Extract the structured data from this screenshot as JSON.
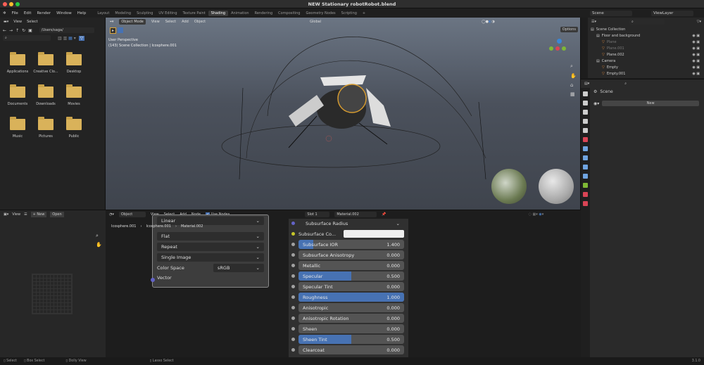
{
  "window": {
    "title": "NEW Stationary robotRobot.blend"
  },
  "menu": [
    "File",
    "Edit",
    "Render",
    "Window",
    "Help"
  ],
  "workspaces": [
    "Layout",
    "Modeling",
    "Sculpting",
    "UV Editing",
    "Texture Paint",
    "Shading",
    "Animation",
    "Rendering",
    "Compositing",
    "Geometry Nodes",
    "Scripting",
    "+"
  ],
  "active_workspace": "Shading",
  "scene": {
    "scene_name": "Scene",
    "view_layer": "ViewLayer"
  },
  "file_browser": {
    "menu": [
      "View",
      "Select"
    ],
    "path": "/Users/saga/",
    "search_placeholder": "",
    "folders": [
      "Applications",
      "Creative Clo...",
      "Desktop",
      "Documents",
      "Downloads",
      "Movies",
      "Music",
      "Pictures",
      "Public"
    ]
  },
  "viewport": {
    "mode": "Object Mode",
    "menu": [
      "View",
      "Select",
      "Add",
      "Object"
    ],
    "orientation": "Global",
    "options": "Options",
    "perspective": "User Perspective",
    "collection_info": "(143) Scene Collection | Icosphere.001"
  },
  "outliner": {
    "items": [
      {
        "label": "Scene Collection",
        "level": 0
      },
      {
        "label": "Floor and background",
        "level": 1
      },
      {
        "label": "Plane",
        "level": 2
      },
      {
        "label": "Plane.001",
        "level": 2
      },
      {
        "label": "Plane.002",
        "level": 2
      },
      {
        "label": "Camera",
        "level": 1
      },
      {
        "label": "Empty",
        "level": 2
      },
      {
        "label": "Empty.001",
        "level": 2
      }
    ]
  },
  "properties": {
    "scene_label": "Scene",
    "new_button": "New"
  },
  "image_editor": {
    "view": "View",
    "new": "New",
    "open": "Open"
  },
  "node_editor": {
    "type": "Object",
    "menu": [
      "View",
      "Select",
      "Add",
      "Node"
    ],
    "use_nodes": "Use Nodes",
    "slot": "Slot 1",
    "material": "Material.002",
    "breadcrumb": [
      "Icosphere.001",
      "Icosphere.001",
      "Material.002"
    ]
  },
  "image_node": {
    "interp": "Linear",
    "projection": "Flat",
    "extension": "Repeat",
    "source": "Single Image",
    "color_space_label": "Color Space",
    "color_space": "sRGB",
    "vector": "Vector"
  },
  "bsdf": {
    "subsurface_radius": "Subsurface Radius",
    "subsurface_color": "Subsurface Co...",
    "rows": [
      {
        "label": "Subsurface IOR",
        "value": "1.400",
        "fill": 0.14
      },
      {
        "label": "Subsurface Anisotropy",
        "value": "0.000",
        "fill": 0
      },
      {
        "label": "Metallic",
        "value": "0.000",
        "fill": 0
      },
      {
        "label": "Specular",
        "value": "0.500",
        "fill": 0.5
      },
      {
        "label": "Specular Tint",
        "value": "0.000",
        "fill": 0
      },
      {
        "label": "Roughness",
        "value": "1.000",
        "fill": 1
      },
      {
        "label": "Anisotropic",
        "value": "0.000",
        "fill": 0
      },
      {
        "label": "Anisotropic Rotation",
        "value": "0.000",
        "fill": 0
      },
      {
        "label": "Sheen",
        "value": "0.000",
        "fill": 0
      },
      {
        "label": "Sheen Tint",
        "value": "0.500",
        "fill": 0.5
      },
      {
        "label": "Clearcoat",
        "value": "0.000",
        "fill": 0
      }
    ]
  },
  "status": {
    "select": "Select",
    "box_select": "Box Select",
    "dolly": "Dolly View",
    "lasso": "Lasso Select",
    "version": "3.1.0"
  }
}
